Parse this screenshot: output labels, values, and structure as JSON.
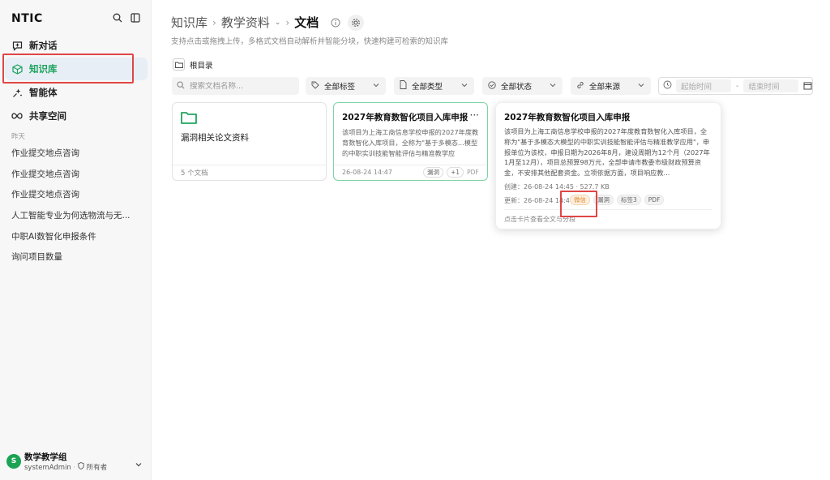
{
  "sidebar": {
    "logo": "NTIC",
    "nav": [
      {
        "label": "新对话",
        "icon": "chat-plus-icon"
      },
      {
        "label": "知识库",
        "icon": "cube-icon",
        "active": true
      },
      {
        "label": "智能体",
        "icon": "sparkle-icon"
      },
      {
        "label": "共享空间",
        "icon": "infinity-icon"
      }
    ],
    "history_label": "昨天",
    "history": [
      "作业提交地点咨询",
      "作业提交地点咨询",
      "作业提交地点咨询",
      "人工智能专业为何选物流与无...",
      "中职AI数智化申报条件",
      "询问项目数量"
    ],
    "user": {
      "avatar": "S",
      "name": "数学教学组",
      "account": "systemAdmin",
      "role": "所有者"
    }
  },
  "header": {
    "crumbs": [
      "知识库",
      "教学资料",
      "文档"
    ],
    "subtitle": "支持点击或拖拽上传，多格式文档自动解析并智能分块，快速构建可检索的知识库"
  },
  "root_label": "根目录",
  "filters": {
    "search_placeholder": "搜索文档名称...",
    "tags": "全部标签",
    "types": "全部类型",
    "status": "全部状态",
    "source": "全部来源",
    "start_placeholder": "起始时间",
    "end_placeholder": "结束时间"
  },
  "folder": {
    "name": "漏洞相关论文资料",
    "count": "5 个文档"
  },
  "doc": {
    "title": "2027年教育数智化项目入库申报",
    "desc": "该项目为上海工商信息学校申报的2027年度教育数智化入库项目，全称为\"基于多模态...模型的中职实训技能智能评估与精准教学应",
    "time": "26-08-24 14:47",
    "chip1": "漏洞",
    "chip2": "+1",
    "type": "PDF"
  },
  "popover": {
    "title": "2027年教育数智化项目入库申报",
    "desc": "该项目为上海工商信息学校申报的2027年度教育数智化入库项目，全称为\"基于多模态大模型的中职实训技能智能评估与精准教学应用\"，申报单位为该校，申报日期为2026年8月，建设周期为12个月（2027年1月至12月），项目总预算98万元，全部申请市教委市级财政预算资金，不安排其他配套资金。立项依据方面，项目响应教...",
    "created": "创建：26-08-24 14:45 · 527.7 KB",
    "updated": "更新：26-08-24 14:47",
    "tags": [
      "微信",
      "漏洞",
      "标签3",
      "PDF"
    ],
    "hint": "点击卡片查看全文与分段"
  }
}
